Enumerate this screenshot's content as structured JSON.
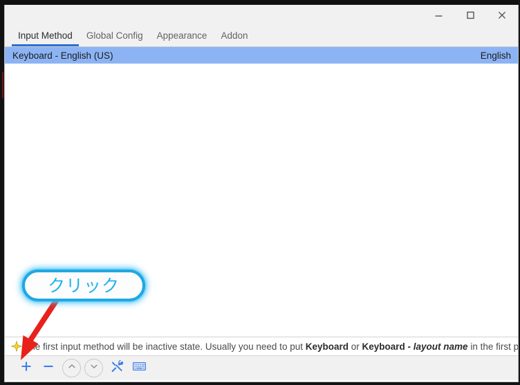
{
  "window": {
    "controls": [
      {
        "name": "minimize",
        "glyph": "minimize-icon",
        "title": "Minimize"
      },
      {
        "name": "maximize",
        "glyph": "maximize-icon",
        "title": "Maximize"
      },
      {
        "name": "close",
        "glyph": "close-icon",
        "title": "Close"
      }
    ]
  },
  "tabs": [
    {
      "label": "Input Method",
      "active": true
    },
    {
      "label": "Global Config",
      "active": false
    },
    {
      "label": "Appearance",
      "active": false
    },
    {
      "label": "Addon",
      "active": false
    }
  ],
  "list": {
    "rows": [
      {
        "name": "Keyboard - English (US)",
        "language": "English",
        "selected": true
      }
    ]
  },
  "hint": {
    "icon": "star-icon",
    "text_part1": "The first input method will be inactive state. Usually you need to put ",
    "bold1": "Keyboard",
    "text_part2": " or ",
    "bold2": "Keyboard - ",
    "italic1": "layout name",
    "text_part3": " in the first place."
  },
  "toolbar": {
    "buttons": [
      {
        "name": "add-input-method",
        "icon": "plus-icon",
        "enabled": true
      },
      {
        "name": "remove-input-method",
        "icon": "minus-icon",
        "enabled": true
      },
      {
        "name": "move-up",
        "icon": "chevron-up-icon",
        "enabled": false
      },
      {
        "name": "move-down",
        "icon": "chevron-down-icon",
        "enabled": false
      },
      {
        "name": "configure",
        "icon": "tools-icon",
        "enabled": true
      },
      {
        "name": "keyboard-layout",
        "icon": "keyboard-icon",
        "enabled": true
      }
    ]
  },
  "annotation": {
    "bubble_text": "クリック",
    "bubble_border_color": "#1ea8e2",
    "bubble_text_color": "#1fb3ef",
    "arrow_color": "#e8211a"
  },
  "colors": {
    "selection": "#8cb4f5",
    "tab_accent": "#2f6fd0",
    "toolbar_icon": "#3d7ee8",
    "chrome": "#f1f1f1"
  }
}
